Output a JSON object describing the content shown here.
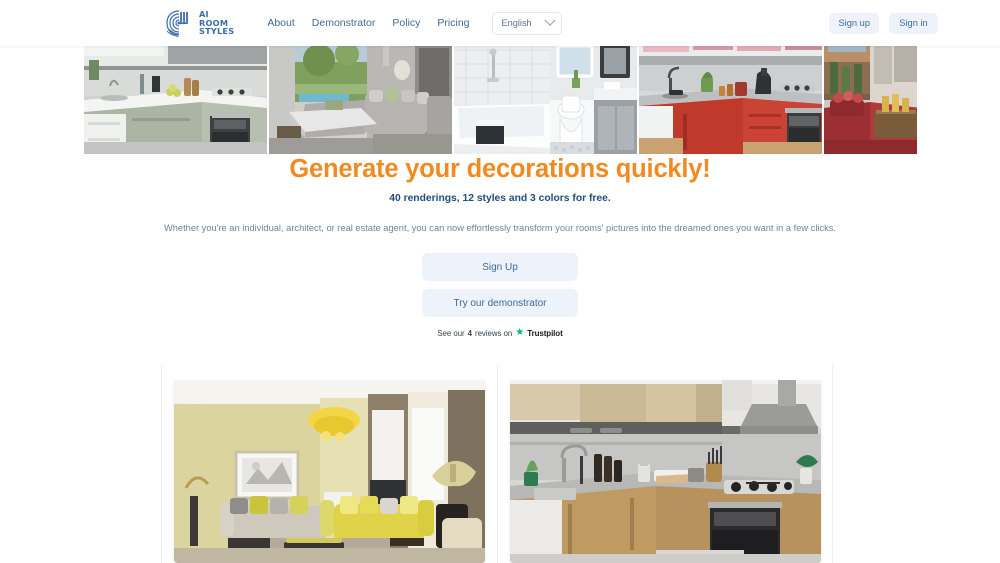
{
  "header": {
    "logo": {
      "icon": "airoomstyles-spiral-logo",
      "line1": "AI",
      "line2": "ROOM",
      "line3": "STYLES"
    },
    "nav": [
      {
        "label": "About"
      },
      {
        "label": "Demonstrator"
      },
      {
        "label": "Policy"
      },
      {
        "label": "Pricing"
      }
    ],
    "language": {
      "selected": "English",
      "icon": "chevron-down-icon"
    },
    "signup_label": "Sign up",
    "signin_label": "Sign in"
  },
  "banner": {
    "images": [
      {
        "alt": "modern-green-kitchen"
      },
      {
        "alt": "grey-living-room-with-garden-view"
      },
      {
        "alt": "white-bathroom-with-tub-and-toilet"
      },
      {
        "alt": "red-kitchen-with-wooden-floor"
      },
      {
        "alt": "red-living-room-with-balcony"
      }
    ]
  },
  "hero": {
    "title": "Generate your decorations quickly!",
    "subtitle": "40 renderings, 12 styles and 3 colors for free.",
    "description": "Whether you're an individual, architect, or real estate agent, you can now effortlessly transform your rooms' pictures into the dreamed ones you want in a few clicks.",
    "primary_cta": "Sign Up",
    "secondary_cta": "Try our demonstrator",
    "trustpilot": {
      "prefix": "See our",
      "count": "4",
      "middle": "reviews on",
      "star_icon": "trustpilot-star-icon",
      "brand": "Trustpilot",
      "star_color": "#00b67a"
    }
  },
  "showcase": {
    "cards": [
      {
        "alt": "yellow-living-room-rendering"
      },
      {
        "alt": "wooden-grey-kitchen-rendering"
      }
    ]
  },
  "colors": {
    "accent_orange": "#f08a21",
    "link_blue": "#3d6a96",
    "heading_navy": "#1f4e79",
    "button_bg": "#eef2fb",
    "body_text": "#6d84a0"
  }
}
